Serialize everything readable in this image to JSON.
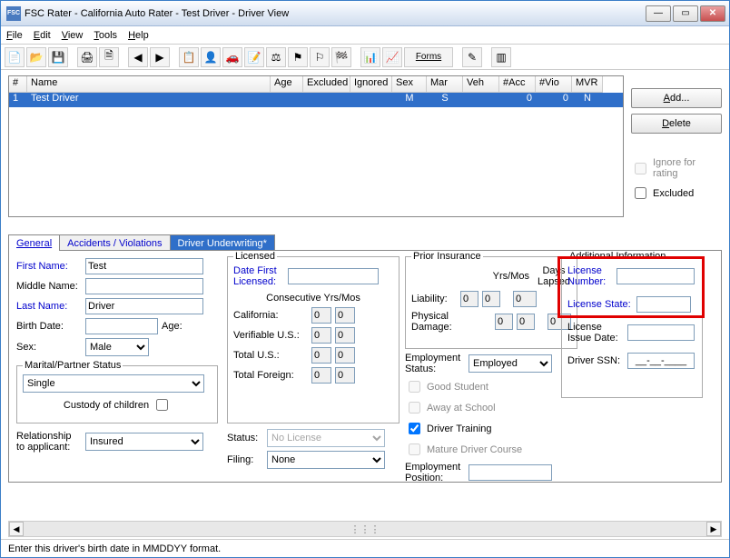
{
  "window_title": "FSC Rater - California Auto Rater - Test Driver - Driver View",
  "menu": {
    "file": "File",
    "edit": "Edit",
    "view": "View",
    "tools": "Tools",
    "help": "Help"
  },
  "toolbar": {
    "forms_label": "Forms"
  },
  "grid": {
    "headers": {
      "num": "#",
      "name": "Name",
      "age": "Age",
      "excluded": "Excluded",
      "ignored": "Ignored",
      "sex": "Sex",
      "mar": "Mar",
      "veh": "Veh",
      "nacc": "#Acc",
      "nvio": "#Vio",
      "mvr": "MVR"
    },
    "row": {
      "num": "1",
      "name": "Test Driver",
      "age": "",
      "excluded": "",
      "ignored": "",
      "sex": "M",
      "mar": "S",
      "veh": "",
      "nacc": "0",
      "nvio": "0",
      "mvr": "N"
    }
  },
  "buttons": {
    "add": "Add...",
    "delete": "Delete"
  },
  "checks": {
    "ignore": "Ignore for rating",
    "excluded": "Excluded"
  },
  "tabs": {
    "general": "General",
    "accidents": "Accidents / Violations",
    "underwriting": "Driver Underwriting*"
  },
  "name_section": {
    "first_lbl": "First Name:",
    "first_val": "Test",
    "middle_lbl": "Middle Name:",
    "middle_val": "",
    "last_lbl": "Last Name:",
    "last_val": "Driver",
    "birth_lbl": "Birth Date:",
    "birth_val": "",
    "age_lbl": "Age:",
    "sex_lbl": "Sex:",
    "sex_val": "Male",
    "marital_legend": "Marital/Partner Status",
    "marital_val": "Single",
    "custody_lbl": "Custody of children",
    "rel_lbl": "Relationship to applicant:",
    "rel_val": "Insured"
  },
  "licensed": {
    "legend": "Licensed",
    "date_first_lbl": "Date First Licensed:",
    "consec_lbl": "Consecutive Yrs/Mos",
    "ca_lbl": "California:",
    "ca_y": "0",
    "ca_m": "0",
    "vus_lbl": "Verifiable U.S.:",
    "vus_y": "0",
    "vus_m": "0",
    "tus_lbl": "Total U.S.:",
    "tus_y": "0",
    "tus_m": "0",
    "tfor_lbl": "Total Foreign:",
    "tfor_y": "0",
    "tfor_m": "0",
    "status_lbl": "Status:",
    "status_val": "No License",
    "filing_lbl": "Filing:",
    "filing_val": "None"
  },
  "prior": {
    "legend": "Prior Insurance",
    "yrsmos_lbl": "Yrs/Mos",
    "days_lbl": "Days Lapsed",
    "liab_lbl": "Liability:",
    "liab_y": "0",
    "liab_m": "0",
    "liab_d": "0",
    "pd_lbl": "Physical Damage:",
    "pd_y": "0",
    "pd_m": "0",
    "pd_d": "0",
    "emp_status_lbl": "Employment Status:",
    "emp_status_val": "Employed",
    "good_student": "Good Student",
    "away_school": "Away at School",
    "driver_training": "Driver Training",
    "mature_course": "Mature Driver Course",
    "emp_pos_lbl": "Employment Position:"
  },
  "addl": {
    "legend": "Additional Information",
    "licnum_lbl": "License Number:",
    "licstate_lbl": "License State:",
    "licdate_lbl": "License Issue Date:",
    "ssn_lbl": "Driver SSN:",
    "ssn_placeholder": "__-__-____"
  },
  "status_text": "Enter this driver's birth date in MMDDYY format."
}
